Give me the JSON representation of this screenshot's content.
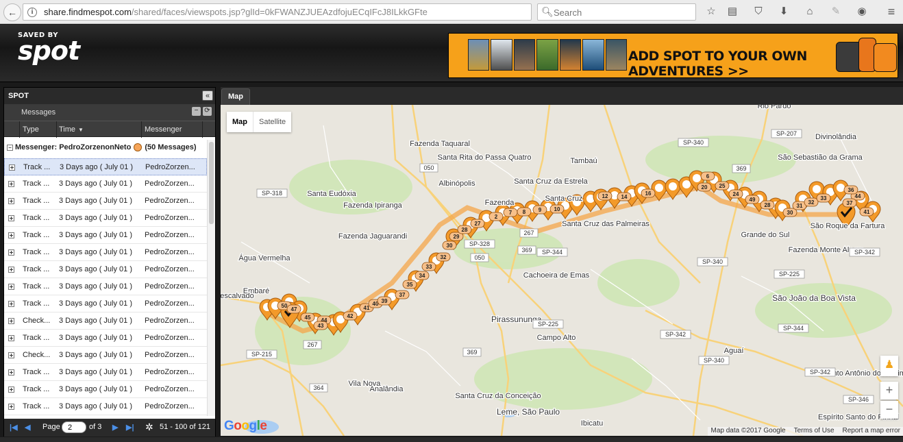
{
  "browser": {
    "url_host": "share.findmespot.com",
    "url_path": "/shared/faces/viewspots.jsp?glId=0kFWANZJUEAzdfojuECqIFcJ8ILkkGFte",
    "search_placeholder": "Search"
  },
  "header": {
    "logo_top": "SAVED BY",
    "logo_main": "spot",
    "banner_text": "ADD SPOT TO YOUR OWN ADVENTURES >>"
  },
  "panel": {
    "title": "SPOT",
    "messages_label": "Messages",
    "columns": [
      "Type",
      "Time",
      "Messenger"
    ],
    "group": {
      "label": "Messenger: PedroZorzenonNeto",
      "count": "(50 Messages)"
    },
    "rows": [
      {
        "type": "Track ...",
        "time": "3 Days ago ( July 01 )",
        "messenger": "PedroZorzen..."
      },
      {
        "type": "Track ...",
        "time": "3 Days ago ( July 01 )",
        "messenger": "PedroZorzen..."
      },
      {
        "type": "Track ...",
        "time": "3 Days ago ( July 01 )",
        "messenger": "PedroZorzen..."
      },
      {
        "type": "Track ...",
        "time": "3 Days ago ( July 01 )",
        "messenger": "PedroZorzen..."
      },
      {
        "type": "Track ...",
        "time": "3 Days ago ( July 01 )",
        "messenger": "PedroZorzen..."
      },
      {
        "type": "Track ...",
        "time": "3 Days ago ( July 01 )",
        "messenger": "PedroZorzen..."
      },
      {
        "type": "Track ...",
        "time": "3 Days ago ( July 01 )",
        "messenger": "PedroZorzen..."
      },
      {
        "type": "Track ...",
        "time": "3 Days ago ( July 01 )",
        "messenger": "PedroZorzen..."
      },
      {
        "type": "Track ...",
        "time": "3 Days ago ( July 01 )",
        "messenger": "PedroZorzen..."
      },
      {
        "type": "Check...",
        "time": "3 Days ago ( July 01 )",
        "messenger": "PedroZorzen..."
      },
      {
        "type": "Track ...",
        "time": "3 Days ago ( July 01 )",
        "messenger": "PedroZorzen..."
      },
      {
        "type": "Check...",
        "time": "3 Days ago ( July 01 )",
        "messenger": "PedroZorzen..."
      },
      {
        "type": "Track ...",
        "time": "3 Days ago ( July 01 )",
        "messenger": "PedroZorzen..."
      },
      {
        "type": "Track ...",
        "time": "3 Days ago ( July 01 )",
        "messenger": "PedroZorzen..."
      },
      {
        "type": "Track ...",
        "time": "3 Days ago ( July 01 )",
        "messenger": "PedroZorzen..."
      }
    ],
    "pager": {
      "page_label": "Page",
      "page_value": "2",
      "of_label": "of 3",
      "range_label": "51 - 100 of 121"
    }
  },
  "map": {
    "tab_label": "Map",
    "type_map": "Map",
    "type_satellite": "Satellite",
    "zoom_in": "+",
    "zoom_out": "−",
    "google_logo": "Google",
    "attrib_data": "Map data ©2017 Google",
    "attrib_terms": "Terms of Use",
    "attrib_report": "Report a map error",
    "places": [
      "Fazenda Taquaral",
      "Santa Rita do Passa Quatro",
      "Tambaú",
      "Rio Pardo",
      "Divinolândia",
      "São Sebastião da Grama",
      "Albinópolis",
      "Santa Cruz da Estrela",
      "Santa Eudóxia",
      "Fazenda Ipiranga",
      "Santa Cruz das Palmeiras",
      "Grande do Sul",
      "São Roque da Fartura",
      "Fazenda Monte Alegre",
      "Fazenda Jaguarandi",
      "Água Vermelha",
      "Cachoeira de Emas",
      "São João da Boa Vista",
      "Embaré",
      "Pirassununga",
      "Campo Alto",
      "Aguaí",
      "Santo Antônio do Jardim",
      "Analândia",
      "Santa Cruz da Conceição",
      "Leme, São Paulo",
      "Ibicatu",
      "Espírito Santo do Pinhal",
      "Descalvado",
      "Fazenda",
      "Vila Nova",
      "Santa Cruz"
    ],
    "roads": [
      "SP-340",
      "SP-207",
      "369",
      "050",
      "SP-318",
      "SP-328",
      "267",
      "SP-340",
      "SP-344",
      "SP-225",
      "SP-225",
      "SP-342",
      "SP-215",
      "369",
      "050",
      "SP-340",
      "364",
      "369",
      "267",
      "SP-342",
      "SP-346",
      "SP-344",
      "SP-342"
    ],
    "markers": [
      "50",
      "47",
      "45",
      "44",
      "43",
      "42",
      "41",
      "40",
      "39",
      "37",
      "35",
      "34",
      "33",
      "32",
      "30",
      "29",
      "28",
      "27",
      "2",
      "7",
      "8",
      "9",
      "10",
      "12",
      "14",
      "16",
      "6",
      "20",
      "25",
      "24",
      "49",
      "28",
      "30",
      "31",
      "32",
      "33",
      "44",
      "37",
      "41",
      "36"
    ]
  }
}
